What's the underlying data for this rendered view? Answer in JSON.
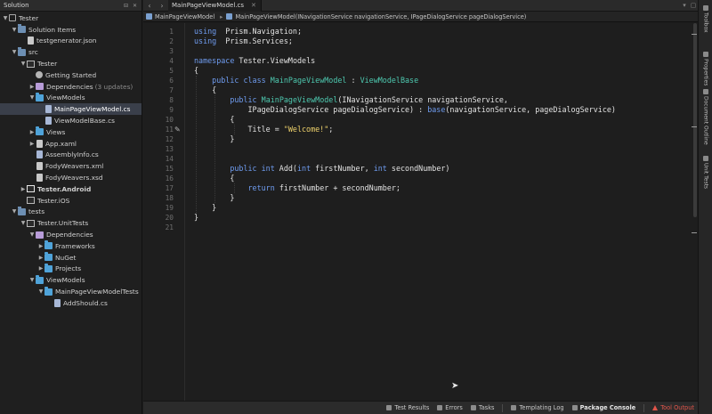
{
  "solution_pad": {
    "title": "Solution",
    "buttons": [
      "⊟",
      "✕"
    ],
    "items": [
      {
        "label": "Tester",
        "indent": 0,
        "arrow": "open",
        "icon": "solution",
        "name": "tree-item-tester-solution"
      },
      {
        "label": "Solution Items",
        "indent": 1,
        "arrow": "open",
        "icon": "folder-dark",
        "name": "tree-item-solution-items"
      },
      {
        "label": "testgenerator.json",
        "indent": 2,
        "arrow": "",
        "icon": "file",
        "name": "tree-item-testgenerator-json"
      },
      {
        "label": "src",
        "indent": 1,
        "arrow": "open",
        "icon": "folder-dark",
        "name": "tree-item-src"
      },
      {
        "label": "Tester",
        "indent": 2,
        "arrow": "open",
        "icon": "project",
        "name": "tree-item-tester-project"
      },
      {
        "label": "Getting Started",
        "indent": 3,
        "arrow": "",
        "icon": "gear",
        "name": "tree-item-getting-started"
      },
      {
        "label": "Dependencies",
        "note": "(3 updates)",
        "indent": 3,
        "arrow": "closed",
        "icon": "deps",
        "name": "tree-item-dependencies"
      },
      {
        "label": "ViewModels",
        "indent": 3,
        "arrow": "open",
        "icon": "folder",
        "name": "tree-item-viewmodels"
      },
      {
        "label": "MainPageViewModel.cs",
        "indent": 4,
        "arrow": "",
        "icon": "file cs",
        "selected": true,
        "name": "tree-item-mainpageviewmodel-cs"
      },
      {
        "label": "ViewModelBase.cs",
        "indent": 4,
        "arrow": "",
        "icon": "file cs",
        "name": "tree-item-viewmodelbase-cs"
      },
      {
        "label": "Views",
        "indent": 3,
        "arrow": "closed",
        "icon": "folder",
        "name": "tree-item-views"
      },
      {
        "label": "App.xaml",
        "indent": 3,
        "arrow": "closed",
        "icon": "file",
        "name": "tree-item-app-xaml"
      },
      {
        "label": "AssemblyInfo.cs",
        "indent": 3,
        "arrow": "",
        "icon": "file cs",
        "name": "tree-item-assemblyinfo-cs"
      },
      {
        "label": "FodyWeavers.xml",
        "indent": 3,
        "arrow": "",
        "icon": "file",
        "name": "tree-item-fodyweavers-xml"
      },
      {
        "label": "FodyWeavers.xsd",
        "indent": 3,
        "arrow": "",
        "icon": "file",
        "name": "tree-item-fodyweavers-xsd"
      },
      {
        "label": "Tester.Android",
        "indent": 2,
        "arrow": "closed",
        "icon": "project bold",
        "bold": true,
        "name": "tree-item-tester-android"
      },
      {
        "label": "Tester.iOS",
        "indent": 2,
        "arrow": "",
        "icon": "project",
        "name": "tree-item-tester-ios"
      },
      {
        "label": "tests",
        "indent": 1,
        "arrow": "open",
        "icon": "folder-dark",
        "name": "tree-item-tests"
      },
      {
        "label": "Tester.UnitTests",
        "indent": 2,
        "arrow": "open",
        "icon": "project",
        "name": "tree-item-tester-unittests"
      },
      {
        "label": "Dependencies",
        "indent": 3,
        "arrow": "open",
        "icon": "deps",
        "name": "tree-item-test-dependencies"
      },
      {
        "label": "Frameworks",
        "indent": 4,
        "arrow": "closed",
        "icon": "folder",
        "name": "tree-item-frameworks"
      },
      {
        "label": "NuGet",
        "indent": 4,
        "arrow": "closed",
        "icon": "folder",
        "name": "tree-item-nuget"
      },
      {
        "label": "Projects",
        "indent": 4,
        "arrow": "closed",
        "icon": "folder",
        "name": "tree-item-projects"
      },
      {
        "label": "ViewModels",
        "indent": 3,
        "arrow": "open",
        "icon": "folder",
        "name": "tree-item-test-viewmodels"
      },
      {
        "label": "MainPageViewModelTests",
        "indent": 4,
        "arrow": "open",
        "icon": "folder",
        "name": "tree-item-mainpageviewmodeltests"
      },
      {
        "label": "AddShould.cs",
        "indent": 5,
        "arrow": "",
        "icon": "file cs",
        "name": "tree-item-addshould-cs"
      }
    ]
  },
  "editor": {
    "nav_back": "‹",
    "nav_forward": "›",
    "tab_label": "MainPageViewModel.cs",
    "tab_close": "✕",
    "tabbar_controls": [
      "▾",
      "▢"
    ],
    "breadcrumb_class": "MainPageViewModel",
    "breadcrumb_member": "MainPageViewModel(INavigationService navigationService, IPageDialogService pageDialogService)",
    "line_numbers": [
      "1",
      "2",
      "3",
      "4",
      "5",
      "6",
      "7",
      "8",
      "9",
      "10",
      "11",
      "12",
      "13",
      "14",
      "15",
      "16",
      "17",
      "18",
      "19",
      "20",
      "21"
    ],
    "code_lines": [
      [
        [
          "kw",
          "using"
        ],
        [
          "",
          "  Prism.Navigation;"
        ]
      ],
      [
        [
          "kw",
          "using"
        ],
        [
          "",
          "  Prism.Services;"
        ]
      ],
      [],
      [
        [
          "kw",
          "namespace"
        ],
        [
          "",
          " Tester.ViewModels"
        ]
      ],
      [
        [
          "",
          "{"
        ]
      ],
      [
        [
          "",
          "    "
        ],
        [
          "kw",
          "public class"
        ],
        [
          "",
          " "
        ],
        [
          "ty",
          "MainPageViewModel"
        ],
        [
          "",
          " : "
        ],
        [
          "ty",
          "ViewModelBase"
        ]
      ],
      [
        [
          "",
          "    {"
        ]
      ],
      [
        [
          "",
          "        "
        ],
        [
          "kw",
          "public"
        ],
        [
          "",
          " "
        ],
        [
          "ty",
          "MainPageViewModel"
        ],
        [
          "",
          "(INavigationService navigationService,"
        ]
      ],
      [
        [
          "",
          "            IPageDialogService pageDialogService) : "
        ],
        [
          "kw",
          "base"
        ],
        [
          "",
          "(navigationService, pageDialogService)"
        ]
      ],
      [
        [
          "",
          "        {"
        ]
      ],
      [
        [
          "",
          "            Title = "
        ],
        [
          "st",
          "\"Welcome!\""
        ],
        [
          "",
          ";"
        ]
      ],
      [
        [
          "",
          "        }"
        ]
      ],
      [],
      [],
      [
        [
          "",
          "        "
        ],
        [
          "kw",
          "public int"
        ],
        [
          "",
          " Add("
        ],
        [
          "kw",
          "int"
        ],
        [
          "",
          " firstNumber, "
        ],
        [
          "kw",
          "int"
        ],
        [
          "",
          " secondNumber)"
        ]
      ],
      [
        [
          "",
          "        {"
        ]
      ],
      [
        [
          "",
          "            "
        ],
        [
          "kw",
          "return"
        ],
        [
          "",
          " firstNumber + secondNumber;"
        ]
      ],
      [
        [
          "",
          "        }"
        ]
      ],
      [
        [
          "",
          "    }"
        ]
      ],
      [
        [
          "",
          "}"
        ]
      ],
      []
    ],
    "pencil_icon": "✎",
    "pencil_line": 11
  },
  "right_dock": {
    "tabs": [
      "Toolbox",
      "Properties",
      "Document Outline",
      "Unit Tests"
    ]
  },
  "status_bar": {
    "items": [
      {
        "label": "Test Results",
        "name": "status-test-results"
      },
      {
        "label": "Errors",
        "name": "status-errors"
      },
      {
        "label": "Tasks",
        "name": "status-tasks"
      },
      {
        "label": "Templating Log",
        "name": "status-templating-log"
      },
      {
        "label": "Package Console",
        "name": "status-package-console",
        "strong": true
      },
      {
        "label": "Tool Output",
        "name": "status-tool-output",
        "alert": true
      }
    ]
  },
  "colors": {
    "keyword": "#6f9cf0",
    "type": "#4ec9b0",
    "string": "#f0d36c",
    "selection": "#3a3f4a",
    "alert": "#e0554a"
  }
}
